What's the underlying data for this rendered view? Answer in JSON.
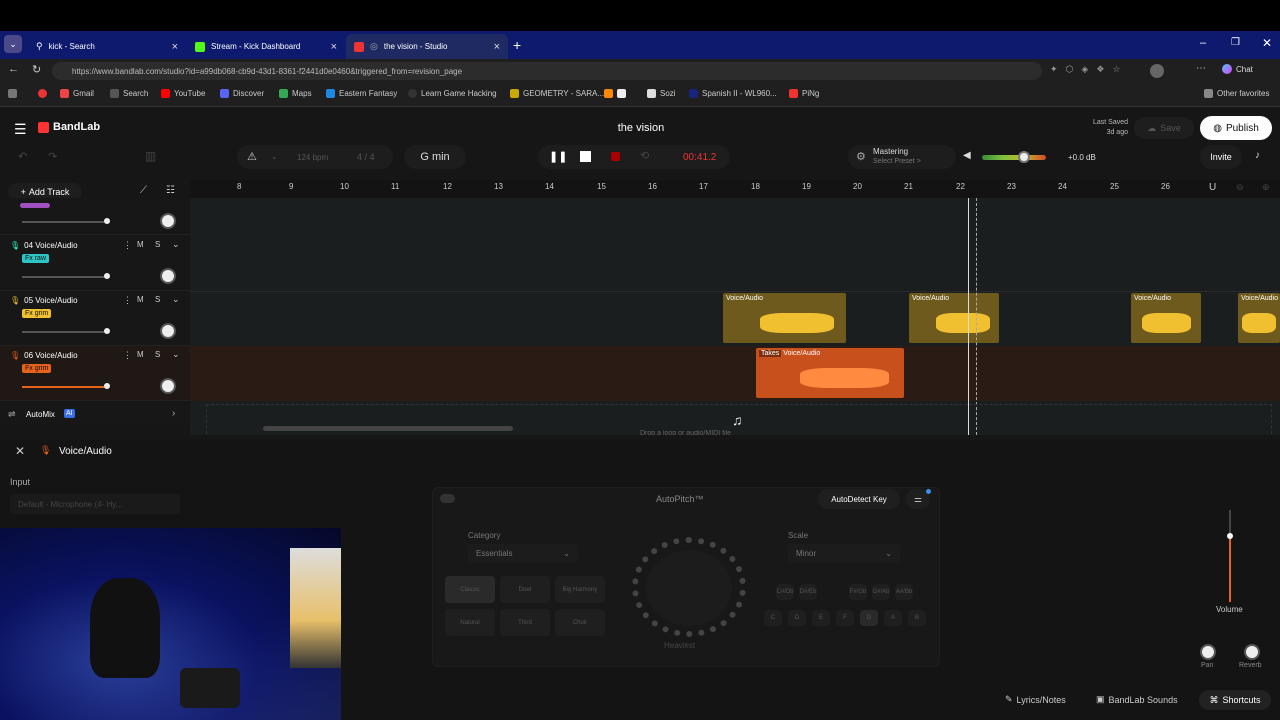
{
  "browser": {
    "tabs": [
      {
        "label": "kick - Search"
      },
      {
        "label": "Stream - Kick Dashboard"
      },
      {
        "label": "the vision - Studio"
      }
    ],
    "url": "https://www.bandlab.com/studio?id=a99db068-cb9d-43d1-8361-f2441d0e0460&triggered_from=revision_page",
    "chat_label": "Chat",
    "favorites": [
      "Gmail",
      "Search",
      "YouTube",
      "Discover",
      "Maps",
      "Eastern Fantasy",
      "Learn Game Hacking",
      "GEOMETRY - SARA...",
      "Sozi",
      "Spanish II - WL960...",
      "PiNg"
    ],
    "other_favorites": "Other favorites"
  },
  "app": {
    "brand": "BandLab",
    "project_title": "the vision",
    "last_saved_label": "Last Saved",
    "last_saved_value": "3d ago",
    "save_label": "Save",
    "publish_label": "Publish",
    "invite_label": "Invite",
    "bpm_value": "124",
    "bpm_unit": "bpm",
    "time_sig": "4 / 4",
    "key": "G min",
    "time": "00:41.2",
    "mastering_label": "Mastering",
    "mastering_sub": "Select Preset >",
    "volume_db": "+0.0 dB",
    "add_track": "Add Track",
    "ruler": [
      "8",
      "9",
      "10",
      "11",
      "12",
      "13",
      "14",
      "15",
      "16",
      "17",
      "18",
      "19",
      "20",
      "21",
      "22",
      "23",
      "24",
      "25",
      "26"
    ],
    "tracks": [
      {
        "name": "04  Voice/Audio",
        "fx": "Fx raw",
        "m": "M",
        "s": "S"
      },
      {
        "name": "05  Voice/Audio",
        "fx": "Fx grim",
        "m": "M",
        "s": "S"
      },
      {
        "name": "06  Voice/Audio",
        "fx": "Fx grim",
        "m": "M",
        "s": "S"
      }
    ],
    "clips": {
      "c1": "Voice/Audio",
      "c2": "Voice/Audio",
      "c3": "Voice/Audio",
      "c4": "Voice/Audio",
      "takes": "Takes",
      "c5": "Voice/Audio"
    },
    "automix": "AutoMix",
    "ai_badge": "AI",
    "drop_hint": "Drop a loop or audio/MIDI file"
  },
  "panel": {
    "title": "Voice/Audio",
    "input_label": "Input",
    "input_value": "Default - Microphone (4- Hy...",
    "autopitch": "AutoPitch™",
    "autodetect": "AutoDetect Key",
    "category_label": "Category",
    "category_value": "Essentials",
    "scale_label": "Scale",
    "scale_value": "Minor",
    "effects": [
      "Classic",
      "Duet",
      "Big Harmony",
      "Natural",
      "Third",
      "Choir"
    ],
    "knob_label": "Heaviest",
    "notes_top": [
      "C#/Db",
      "D#/Eb",
      "F#/Gb",
      "G#/Ab",
      "A#/Bb"
    ],
    "notes": [
      "C",
      "D",
      "E",
      "F",
      "G",
      "A",
      "B"
    ],
    "volume_label": "Volume",
    "pan_label": "Pan",
    "reverb_label": "Reverb"
  },
  "footer": {
    "lyrics": "Lyrics/Notes",
    "sounds": "BandLab Sounds",
    "shortcuts": "Shortcuts"
  }
}
